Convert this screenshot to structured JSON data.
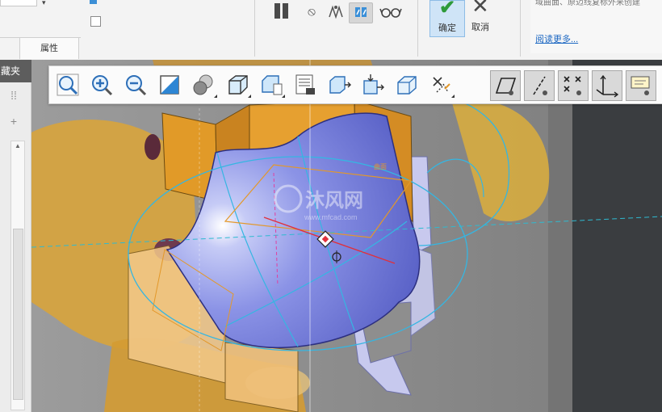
{
  "ribbon": {
    "tab_attributes": "属性",
    "ok_label": "确定",
    "cancel_label": "取消",
    "help_text": "域曲面、原迈线复标外来创建",
    "help_link": "阅读更多..."
  },
  "left_panel": {
    "header": "藏夹"
  },
  "viewport": {
    "orange_label": "曲面",
    "watermark_main": "沐风网",
    "watermark_sub": "www.mfcad.com"
  },
  "view_toolbar": {
    "icons": [
      "zoom-all-icon",
      "zoom-in-icon",
      "zoom-out-icon",
      "repaint-icon",
      "appearance-icon",
      "display-style-icon",
      "saved-orientation-icon",
      "view-manager-icon",
      "perspective-icon",
      "spin-center-icon",
      "section-icon",
      "datum-planes-icon",
      "datum-axes-icon",
      "datum-points-icon",
      "coordinate-systems-icon",
      "annotations-icon"
    ]
  },
  "colors": {
    "surface_blue": "#8e96e8",
    "feature_orange": "#e39c2c",
    "curve_cyan": "#3cb8e0",
    "accent_red": "#e0303c",
    "ok_green": "#2e9a3a"
  }
}
